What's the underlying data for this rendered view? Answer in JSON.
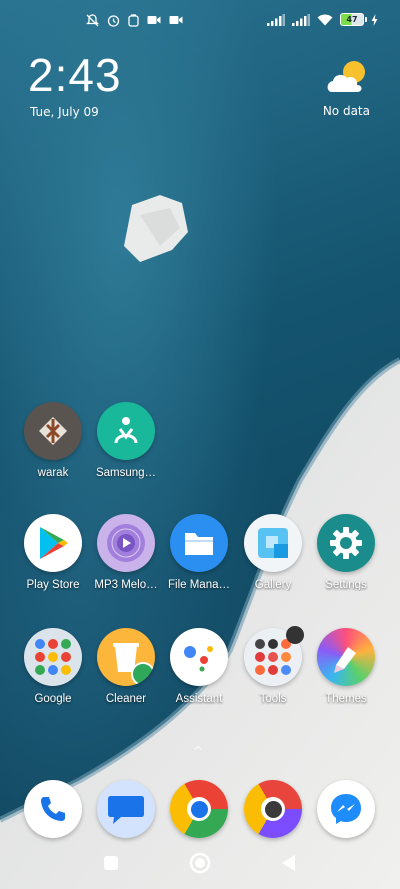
{
  "status_bar": {
    "battery_level": "47",
    "left_icons": [
      "muted-bell-icon",
      "alarm-icon",
      "data-saver-icon",
      "video-icon",
      "video-icon"
    ],
    "right_icons": [
      "signal-icon",
      "signal-icon",
      "wifi-icon",
      "battery-icon",
      "charging-icon"
    ]
  },
  "clock": {
    "time": "2:43",
    "date": "Tue, July 09"
  },
  "weather": {
    "status": "No data",
    "icon": "partly-cloudy-icon"
  },
  "apps": {
    "row1": [
      {
        "label": "warak",
        "icon": "warak-icon"
      },
      {
        "label": "Samsung…",
        "icon": "samsung-health-icon"
      }
    ],
    "row2": [
      {
        "label": "Play Store",
        "icon": "play-store-icon"
      },
      {
        "label": "MP3 Melo…",
        "icon": "mp3-melody-icon"
      },
      {
        "label": "File Mana…",
        "icon": "file-manager-icon"
      },
      {
        "label": "Gallery",
        "icon": "gallery-icon"
      },
      {
        "label": "Settings",
        "icon": "settings-icon"
      }
    ],
    "row3": [
      {
        "label": "Google",
        "icon": "google-folder-icon"
      },
      {
        "label": "Cleaner",
        "icon": "cleaner-icon"
      },
      {
        "label": "Assistant",
        "icon": "assistant-icon"
      },
      {
        "label": "Tools",
        "icon": "tools-folder-icon"
      },
      {
        "label": "Themes",
        "icon": "themes-icon"
      }
    ]
  },
  "dock": [
    {
      "icon": "phone-icon"
    },
    {
      "icon": "messages-icon"
    },
    {
      "icon": "chrome-icon"
    },
    {
      "icon": "chrome-dev-icon"
    },
    {
      "icon": "messenger-icon"
    }
  ],
  "navigation": {
    "buttons": [
      "recents-button",
      "home-button",
      "back-button"
    ]
  },
  "colors": {
    "ocean": "#1e5f7c",
    "sand": "#e6e6e4"
  }
}
